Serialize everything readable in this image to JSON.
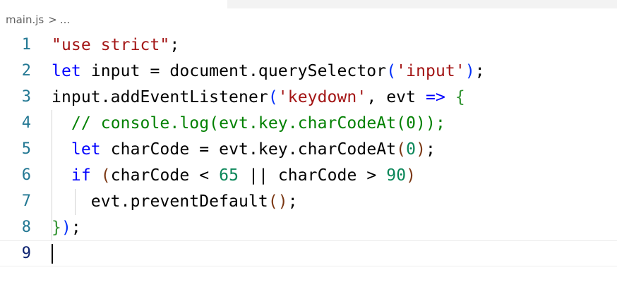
{
  "breadcrumb": {
    "file": "main.js",
    "separator": ">",
    "more": "..."
  },
  "lines": [
    {
      "n": "1",
      "tokens": [
        {
          "t": "\"use strict\"",
          "c": "str"
        },
        {
          "t": ";",
          "c": ""
        }
      ]
    },
    {
      "n": "2",
      "tokens": [
        {
          "t": "let",
          "c": "kw"
        },
        {
          "t": " input = document.querySelector",
          "c": ""
        },
        {
          "t": "(",
          "c": "br1"
        },
        {
          "t": "'input'",
          "c": "str"
        },
        {
          "t": ")",
          "c": "br1"
        },
        {
          "t": ";",
          "c": ""
        }
      ]
    },
    {
      "n": "3",
      "tokens": [
        {
          "t": "input.addEventListener",
          "c": ""
        },
        {
          "t": "(",
          "c": "br1"
        },
        {
          "t": "'keydown'",
          "c": "str"
        },
        {
          "t": ", evt ",
          "c": ""
        },
        {
          "t": "=>",
          "c": "kw"
        },
        {
          "t": " ",
          "c": ""
        },
        {
          "t": "{",
          "c": "br2"
        }
      ]
    },
    {
      "n": "4",
      "tokens": [
        {
          "t": "  ",
          "c": ""
        },
        {
          "t": "// console.log(evt.key.charCodeAt(0));",
          "c": "cm"
        }
      ]
    },
    {
      "n": "5",
      "tokens": [
        {
          "t": "  ",
          "c": ""
        },
        {
          "t": "let",
          "c": "kw"
        },
        {
          "t": " charCode = evt.key.charCodeAt",
          "c": ""
        },
        {
          "t": "(",
          "c": "br3"
        },
        {
          "t": "0",
          "c": "num"
        },
        {
          "t": ")",
          "c": "br3"
        },
        {
          "t": ";",
          "c": ""
        }
      ]
    },
    {
      "n": "6",
      "tokens": [
        {
          "t": "  ",
          "c": ""
        },
        {
          "t": "if",
          "c": "kw"
        },
        {
          "t": " ",
          "c": ""
        },
        {
          "t": "(",
          "c": "br3"
        },
        {
          "t": "charCode < ",
          "c": ""
        },
        {
          "t": "65",
          "c": "num"
        },
        {
          "t": " || charCode > ",
          "c": ""
        },
        {
          "t": "90",
          "c": "num"
        },
        {
          "t": ")",
          "c": "br3"
        }
      ]
    },
    {
      "n": "7",
      "tokens": [
        {
          "t": "    evt.preventDefault",
          "c": ""
        },
        {
          "t": "(",
          "c": "br3"
        },
        {
          "t": ")",
          "c": "br3"
        },
        {
          "t": ";",
          "c": ""
        }
      ]
    },
    {
      "n": "8",
      "tokens": [
        {
          "t": "}",
          "c": "br2"
        },
        {
          "t": ")",
          "c": "br1"
        },
        {
          "t": ";",
          "c": ""
        }
      ]
    },
    {
      "n": "9",
      "tokens": [
        {
          "t": "",
          "c": ""
        }
      ]
    }
  ],
  "colors": {
    "keyword": "#0000ff",
    "string": "#a31515",
    "comment": "#008000",
    "number": "#098658",
    "line_number": "#237893",
    "active_line_number": "#0b216f"
  }
}
